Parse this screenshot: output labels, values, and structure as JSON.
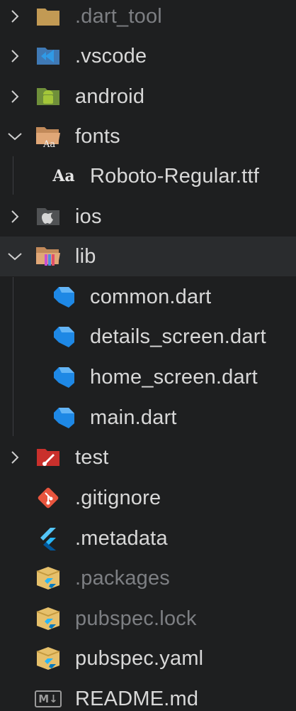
{
  "explorer": {
    "items": [
      {
        "label": ".dart_tool",
        "icon": "folder-icon",
        "expanded": false
      },
      {
        "label": ".vscode",
        "icon": "vscode-folder-icon",
        "expanded": false
      },
      {
        "label": "android",
        "icon": "android-folder-icon",
        "expanded": false
      },
      {
        "label": "fonts",
        "icon": "fonts-folder-icon",
        "expanded": true
      },
      {
        "label": "Roboto-Regular.ttf",
        "icon": "font-file-icon"
      },
      {
        "label": "ios",
        "icon": "ios-folder-icon",
        "expanded": false
      },
      {
        "label": "lib",
        "icon": "lib-folder-icon",
        "expanded": true
      },
      {
        "label": "common.dart",
        "icon": "dart-file-icon"
      },
      {
        "label": "details_screen.dart",
        "icon": "dart-file-icon"
      },
      {
        "label": "home_screen.dart",
        "icon": "dart-file-icon"
      },
      {
        "label": "main.dart",
        "icon": "dart-file-icon"
      },
      {
        "label": "test",
        "icon": "test-folder-icon",
        "expanded": false
      },
      {
        "label": ".gitignore",
        "icon": "git-icon"
      },
      {
        "label": ".metadata",
        "icon": "flutter-icon"
      },
      {
        "label": ".packages",
        "icon": "package-icon"
      },
      {
        "label": "pubspec.lock",
        "icon": "package-icon"
      },
      {
        "label": "pubspec.yaml",
        "icon": "package-icon"
      },
      {
        "label": "README.md",
        "icon": "markdown-icon"
      }
    ],
    "font_glyph": "Aa",
    "markdown_glyph": "M↓",
    "colors": {
      "background": "#1e1f20",
      "selected_row": "#2a2c2e",
      "text": "#d8d8d8",
      "dim_text": "#7d7f83",
      "dart_blue": "#1e88e5"
    }
  }
}
